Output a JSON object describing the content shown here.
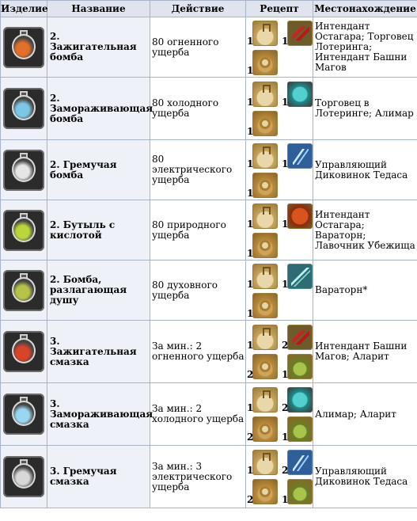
{
  "headers": [
    "Изделие",
    "Название",
    "Действие",
    "Рецепт",
    "Местонахождение"
  ],
  "colors": {
    "header_bg": "#dfe4ee",
    "border": "#a9b3c6",
    "name_bg": "#eef1f7"
  },
  "rows": [
    {
      "icon": "fire-bomb-icon",
      "name": "2. Зажигательная бомба",
      "action": "80 огненного ущерба",
      "ingredients": [
        {
          "qty": "1",
          "icon": "flask-icon"
        },
        {
          "qty": "1",
          "icon": "dragonthorn-icon"
        },
        {
          "qty": "1",
          "icon": "concentrator-icon"
        }
      ],
      "location": "Интендант Остагара; Торговец Лотеринга; Интендант Башни Магов"
    },
    {
      "icon": "freeze-bomb-icon",
      "name": "2. Замораживающая бомба",
      "action": "80 холодного ущерба",
      "ingredients": [
        {
          "qty": "1",
          "icon": "flask-icon"
        },
        {
          "qty": "1",
          "icon": "frostrock-icon"
        },
        {
          "qty": "1",
          "icon": "concentrator-icon"
        }
      ],
      "location": "Торговец в Лотеринге; Алимар"
    },
    {
      "icon": "shock-bomb-icon",
      "name": "2. Гремучая бомба",
      "action": "80 электрического ущерба",
      "ingredients": [
        {
          "qty": "1",
          "icon": "flask-icon"
        },
        {
          "qty": "1",
          "icon": "lightning-icon"
        },
        {
          "qty": "1",
          "icon": "concentrator-icon"
        }
      ],
      "location": "Управляющий Диковинок Тедаса"
    },
    {
      "icon": "acid-flask-icon",
      "name": "2. Бутыль с кислотой",
      "action": "80 природного ущерба",
      "ingredients": [
        {
          "qty": "1",
          "icon": "flask-icon"
        },
        {
          "qty": "1",
          "icon": "lifestone-icon"
        },
        {
          "qty": "1",
          "icon": "concentrator-icon"
        }
      ],
      "location": "Интендант Остагара; Вараторн; Лавочник Убежища"
    },
    {
      "icon": "soulrot-bomb-icon",
      "name": "2. Бомба, разлагающая душу",
      "action": "80 духовного ущерба",
      "ingredients": [
        {
          "qty": "1",
          "icon": "flask-icon"
        },
        {
          "qty": "1",
          "icon": "spirit-shard-icon"
        },
        {
          "qty": "1",
          "icon": "concentrator-icon"
        }
      ],
      "location": "Вараторн*"
    },
    {
      "icon": "fire-coating-icon",
      "name": "3. Зажигательная смазка",
      "action": "За мин.: 2 огненного ущерба",
      "ingredients": [
        {
          "qty": "1",
          "icon": "flask-icon"
        },
        {
          "qty": "2",
          "icon": "dragonthorn-icon"
        },
        {
          "qty": "2",
          "icon": "concentrator-icon"
        },
        {
          "qty": "1",
          "icon": "distillation-agent-icon"
        }
      ],
      "location": "Интендант Башни Магов; Аларит"
    },
    {
      "icon": "frost-coating-icon",
      "name": "3. Замораживающая смазка",
      "action": "За мин.: 2 холодного ущерба",
      "ingredients": [
        {
          "qty": "1",
          "icon": "flask-icon"
        },
        {
          "qty": "2",
          "icon": "frostrock-icon"
        },
        {
          "qty": "2",
          "icon": "concentrator-icon"
        },
        {
          "qty": "1",
          "icon": "distillation-agent-icon"
        }
      ],
      "location": "Алимар; Аларит"
    },
    {
      "icon": "shock-coating-icon",
      "name": "3. Гремучая смазка",
      "action": "За мин.: 3 электрического ущерба",
      "ingredients": [
        {
          "qty": "1",
          "icon": "flask-icon"
        },
        {
          "qty": "2",
          "icon": "lightning-icon"
        },
        {
          "qty": "2",
          "icon": "concentrator-icon"
        },
        {
          "qty": "1",
          "icon": "distillation-agent-icon"
        }
      ],
      "location": "Управляющий Диковинок Тедаса"
    }
  ]
}
